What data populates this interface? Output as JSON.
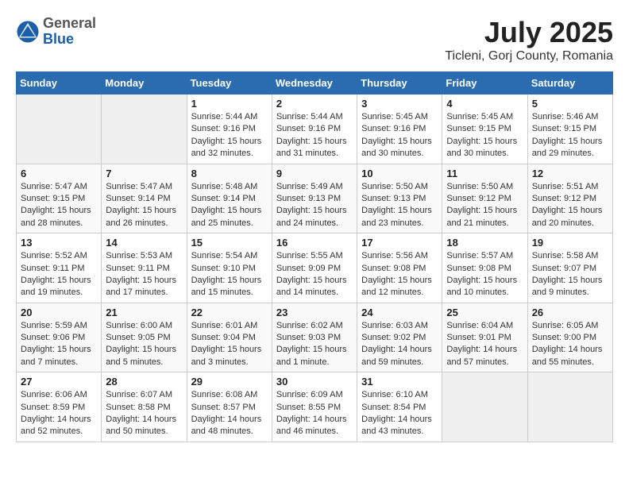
{
  "header": {
    "logo": {
      "general": "General",
      "blue": "Blue"
    },
    "title": "July 2025",
    "location": "Ticleni, Gorj County, Romania"
  },
  "calendar": {
    "days_of_week": [
      "Sunday",
      "Monday",
      "Tuesday",
      "Wednesday",
      "Thursday",
      "Friday",
      "Saturday"
    ],
    "weeks": [
      [
        null,
        null,
        {
          "day": "1",
          "sunrise": "Sunrise: 5:44 AM",
          "sunset": "Sunset: 9:16 PM",
          "daylight": "Daylight: 15 hours and 32 minutes."
        },
        {
          "day": "2",
          "sunrise": "Sunrise: 5:44 AM",
          "sunset": "Sunset: 9:16 PM",
          "daylight": "Daylight: 15 hours and 31 minutes."
        },
        {
          "day": "3",
          "sunrise": "Sunrise: 5:45 AM",
          "sunset": "Sunset: 9:16 PM",
          "daylight": "Daylight: 15 hours and 30 minutes."
        },
        {
          "day": "4",
          "sunrise": "Sunrise: 5:45 AM",
          "sunset": "Sunset: 9:15 PM",
          "daylight": "Daylight: 15 hours and 30 minutes."
        },
        {
          "day": "5",
          "sunrise": "Sunrise: 5:46 AM",
          "sunset": "Sunset: 9:15 PM",
          "daylight": "Daylight: 15 hours and 29 minutes."
        }
      ],
      [
        {
          "day": "6",
          "sunrise": "Sunrise: 5:47 AM",
          "sunset": "Sunset: 9:15 PM",
          "daylight": "Daylight: 15 hours and 28 minutes."
        },
        {
          "day": "7",
          "sunrise": "Sunrise: 5:47 AM",
          "sunset": "Sunset: 9:14 PM",
          "daylight": "Daylight: 15 hours and 26 minutes."
        },
        {
          "day": "8",
          "sunrise": "Sunrise: 5:48 AM",
          "sunset": "Sunset: 9:14 PM",
          "daylight": "Daylight: 15 hours and 25 minutes."
        },
        {
          "day": "9",
          "sunrise": "Sunrise: 5:49 AM",
          "sunset": "Sunset: 9:13 PM",
          "daylight": "Daylight: 15 hours and 24 minutes."
        },
        {
          "day": "10",
          "sunrise": "Sunrise: 5:50 AM",
          "sunset": "Sunset: 9:13 PM",
          "daylight": "Daylight: 15 hours and 23 minutes."
        },
        {
          "day": "11",
          "sunrise": "Sunrise: 5:50 AM",
          "sunset": "Sunset: 9:12 PM",
          "daylight": "Daylight: 15 hours and 21 minutes."
        },
        {
          "day": "12",
          "sunrise": "Sunrise: 5:51 AM",
          "sunset": "Sunset: 9:12 PM",
          "daylight": "Daylight: 15 hours and 20 minutes."
        }
      ],
      [
        {
          "day": "13",
          "sunrise": "Sunrise: 5:52 AM",
          "sunset": "Sunset: 9:11 PM",
          "daylight": "Daylight: 15 hours and 19 minutes."
        },
        {
          "day": "14",
          "sunrise": "Sunrise: 5:53 AM",
          "sunset": "Sunset: 9:11 PM",
          "daylight": "Daylight: 15 hours and 17 minutes."
        },
        {
          "day": "15",
          "sunrise": "Sunrise: 5:54 AM",
          "sunset": "Sunset: 9:10 PM",
          "daylight": "Daylight: 15 hours and 15 minutes."
        },
        {
          "day": "16",
          "sunrise": "Sunrise: 5:55 AM",
          "sunset": "Sunset: 9:09 PM",
          "daylight": "Daylight: 15 hours and 14 minutes."
        },
        {
          "day": "17",
          "sunrise": "Sunrise: 5:56 AM",
          "sunset": "Sunset: 9:08 PM",
          "daylight": "Daylight: 15 hours and 12 minutes."
        },
        {
          "day": "18",
          "sunrise": "Sunrise: 5:57 AM",
          "sunset": "Sunset: 9:08 PM",
          "daylight": "Daylight: 15 hours and 10 minutes."
        },
        {
          "day": "19",
          "sunrise": "Sunrise: 5:58 AM",
          "sunset": "Sunset: 9:07 PM",
          "daylight": "Daylight: 15 hours and 9 minutes."
        }
      ],
      [
        {
          "day": "20",
          "sunrise": "Sunrise: 5:59 AM",
          "sunset": "Sunset: 9:06 PM",
          "daylight": "Daylight: 15 hours and 7 minutes."
        },
        {
          "day": "21",
          "sunrise": "Sunrise: 6:00 AM",
          "sunset": "Sunset: 9:05 PM",
          "daylight": "Daylight: 15 hours and 5 minutes."
        },
        {
          "day": "22",
          "sunrise": "Sunrise: 6:01 AM",
          "sunset": "Sunset: 9:04 PM",
          "daylight": "Daylight: 15 hours and 3 minutes."
        },
        {
          "day": "23",
          "sunrise": "Sunrise: 6:02 AM",
          "sunset": "Sunset: 9:03 PM",
          "daylight": "Daylight: 15 hours and 1 minute."
        },
        {
          "day": "24",
          "sunrise": "Sunrise: 6:03 AM",
          "sunset": "Sunset: 9:02 PM",
          "daylight": "Daylight: 14 hours and 59 minutes."
        },
        {
          "day": "25",
          "sunrise": "Sunrise: 6:04 AM",
          "sunset": "Sunset: 9:01 PM",
          "daylight": "Daylight: 14 hours and 57 minutes."
        },
        {
          "day": "26",
          "sunrise": "Sunrise: 6:05 AM",
          "sunset": "Sunset: 9:00 PM",
          "daylight": "Daylight: 14 hours and 55 minutes."
        }
      ],
      [
        {
          "day": "27",
          "sunrise": "Sunrise: 6:06 AM",
          "sunset": "Sunset: 8:59 PM",
          "daylight": "Daylight: 14 hours and 52 minutes."
        },
        {
          "day": "28",
          "sunrise": "Sunrise: 6:07 AM",
          "sunset": "Sunset: 8:58 PM",
          "daylight": "Daylight: 14 hours and 50 minutes."
        },
        {
          "day": "29",
          "sunrise": "Sunrise: 6:08 AM",
          "sunset": "Sunset: 8:57 PM",
          "daylight": "Daylight: 14 hours and 48 minutes."
        },
        {
          "day": "30",
          "sunrise": "Sunrise: 6:09 AM",
          "sunset": "Sunset: 8:55 PM",
          "daylight": "Daylight: 14 hours and 46 minutes."
        },
        {
          "day": "31",
          "sunrise": "Sunrise: 6:10 AM",
          "sunset": "Sunset: 8:54 PM",
          "daylight": "Daylight: 14 hours and 43 minutes."
        },
        null,
        null
      ]
    ]
  }
}
